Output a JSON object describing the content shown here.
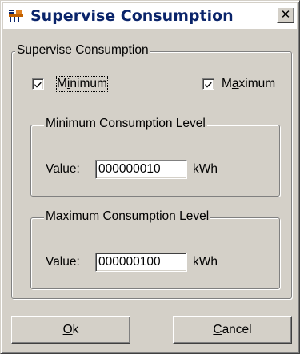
{
  "window": {
    "title": "Supervise Consumption",
    "icon": "app-icon",
    "close_glyph": "✕"
  },
  "outer_group": {
    "label": "Supervise Consumption"
  },
  "checkboxes": {
    "minimum": {
      "prefix": "M",
      "mnemonic": "i",
      "suffix": "nimum",
      "checked": true
    },
    "maximum": {
      "prefix": "M",
      "mnemonic": "a",
      "suffix": "ximum",
      "checked": true
    }
  },
  "min_group": {
    "label": "Minimum Consumption Level",
    "value_label": "Value:",
    "value": "000000010",
    "unit": "kWh"
  },
  "max_group": {
    "label": "Maximum Consumption Level",
    "value_label": "Value:",
    "value": "000000100",
    "unit": "kWh"
  },
  "buttons": {
    "ok": {
      "mnemonic": "O",
      "rest": "k"
    },
    "cancel": {
      "mnemonic": "C",
      "rest": "ancel"
    }
  },
  "colors": {
    "title_text": "#0a246a",
    "face": "#d4d0c8"
  }
}
